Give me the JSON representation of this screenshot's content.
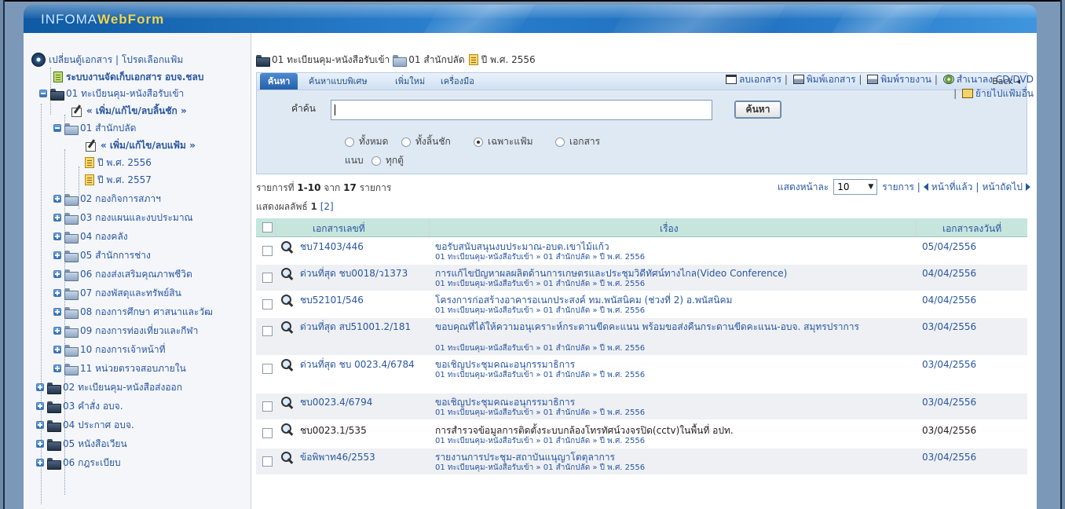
{
  "app": {
    "logo_a": "INFOMA",
    "logo_b": "WebForm"
  },
  "sidebar": {
    "top_link": "เปลี่ยนตู้เอกสาร | โปรดเลือกแฟ้ม",
    "system_title": "ระบบงานจัดเก็บเอกสาร อบจ.ชลบ",
    "items": [
      {
        "label": "01 ทะเบียนคุม-หนังสือรับเข้า"
      },
      {
        "label": "« เพิ่ม/แก้ไข/ลบลิ้นชัก »"
      },
      {
        "label": "01 สำนักปลัด"
      },
      {
        "label": "« เพิ่ม/แก้ไข/ลบแฟ้ม »"
      },
      {
        "label": "ปี พ.ศ. 2556"
      },
      {
        "label": "ปี พ.ศ. 2557"
      },
      {
        "label": "02 กองกิจการสภาฯ"
      },
      {
        "label": "03 กองแผนและงบประมาณ"
      },
      {
        "label": "04 กองคลัง"
      },
      {
        "label": "05 สำนักการช่าง"
      },
      {
        "label": "06 กองส่งเสริมคุณภาพชีวิต"
      },
      {
        "label": "07 กองพัสดุและทรัพย์สิน"
      },
      {
        "label": "08 กองการศึกษา ศาสนาและวัฒ"
      },
      {
        "label": "09 กองการท่องเที่ยวและกีฬา"
      },
      {
        "label": "10 กองการเจ้าหน้าที่"
      },
      {
        "label": "11 หน่วยตรวจสอบภายใน"
      },
      {
        "label": "02 ทะเบียนคุม-หนังสือส่งออก"
      },
      {
        "label": "03 คำสั่ง อบจ."
      },
      {
        "label": "04 ประกาศ อบจ."
      },
      {
        "label": "05 หนังสือเวียน"
      },
      {
        "label": "06 กฎระเบียบ"
      }
    ]
  },
  "breadcrumb": {
    "c1": "01 ทะเบียนคุม-หนังสือรับเข้า",
    "c2": "01 สำนักปลัด",
    "c3": "ปี พ.ศ. 2556"
  },
  "tabs": {
    "search": "ค้นหา",
    "advanced": "ค้นหาแบบพิเศษ",
    "add": "เพิ่มใหม่",
    "tools": "เครื่องมือ",
    "back": "Back ◂"
  },
  "search": {
    "keyword_label": "คำค้น",
    "keyword_value": "",
    "button": "ค้นหา",
    "scope": [
      "ทั้งหมด",
      "ทั้งลิ้นชัก",
      "เฉพาะแฟ้ม",
      "เอกสาร"
    ],
    "attach_label": "แนบ",
    "attach_opt": "ทุกตู้"
  },
  "actions": {
    "delete": "ลบเอกสาร",
    "print_doc": "พิมพ์เอกสาร",
    "print_report": "พิมพ์รายงาน",
    "copy_cd": "สำเนาลง CD/DVD",
    "move": "ย้ายไปแฟ้มอื่น"
  },
  "summary": {
    "prefix": "รายการที่",
    "range": "1-10",
    "from": "จาก",
    "total": "17",
    "suffix": "รายการ"
  },
  "paging": {
    "perpage_label": "แสดงหน้าละ",
    "perpage_value": "10",
    "items_label": "รายการ |",
    "prev": "หน้าที่แล้ว",
    "sep": "|",
    "next": "หน้าถัดไป",
    "results_label": "แสดงผลลัพธ์",
    "current_page": "1",
    "page2": "[2]"
  },
  "table": {
    "headers": {
      "docno": "เอกสารเลขที่",
      "subject": "เรื่อง",
      "date": "เอกสารลงวันที่"
    },
    "rows": [
      {
        "docno": "ชบ71403/446",
        "title": "ขอรับสนับสนุนงบประมาณ-อบต.เขาไม้แก้ว",
        "path": "01 ทะเบียนคุม-หนังสือรับเข้า » 01 สำนักปลัด » ปี พ.ศ. 2556",
        "date": "05/04/2556"
      },
      {
        "docno": "ด่วนที่สุด ชบ0018/ว1373",
        "title": "การแก้ไขปัญหาผลผลิตด้านการเกษตรและประชุมวิดีทัศน์ทางไกล(Video Conference)",
        "path": "01 ทะเบียนคุม-หนังสือรับเข้า » 01 สำนักปลัด » ปี พ.ศ. 2556",
        "date": "04/04/2556"
      },
      {
        "docno": "ชบ52101/546",
        "title": "โครงการก่อสร้างอาคารอเนกประสงค์ ทม.พนัสนิคม (ช่วงที่ 2) อ.พนัสนิคม",
        "path": "01 ทะเบียนคุม-หนังสือรับเข้า » 01 สำนักปลัด » ปี พ.ศ. 2556",
        "date": "04/04/2556"
      },
      {
        "docno": "ด่วนที่สุด สป51001.2/181",
        "title": "ขอบคุณที่ได้ให้ความอนุเคราะห์กระดานขีดคะแนน พร้อมขอส่งคืนกระดานขีดคะแนน-อบจ. สมุทรปราการ",
        "path": "01 ทะเบียนคุม-หนังสือรับเข้า » 01 สำนักปลัด » ปี พ.ศ. 2556",
        "date": "03/04/2556"
      },
      {
        "docno": "ด่วนที่สุด ชบ 0023.4/6784",
        "title": "ขอเชิญประชุมคณะอนุกรรมาธิการ",
        "path": "01 ทะเบียนคุม-หนังสือรับเข้า » 01 สำนักปลัด » ปี พ.ศ. 2556",
        "date": "03/04/2556"
      },
      {
        "docno": "ชบ0023.4/6794",
        "title": "ขอเชิญประชุมคณะอนุกรรมาธิการ",
        "path": "01 ทะเบียนคุม-หนังสือรับเข้า » 01 สำนักปลัด » ปี พ.ศ. 2556",
        "date": "03/04/2556"
      },
      {
        "docno": "ชบ0023.1/535",
        "title": "การสำรวจข้อมูลการติดตั้งระบบกล้องโทรทัศน์วงจรปิด(cctv)ในพื้นที่ อปท.",
        "path": "01 ทะเบียนคุม-หนังสือรับเข้า » 01 สำนักปลัด » ปี พ.ศ. 2556",
        "date": "03/04/2556"
      },
      {
        "docno": "ข้อพิพาท46/2553",
        "title": "รายงานการประชุม-สถาบันแนุญาโตตุลาการ",
        "path": "01 ทะเบียนคุม-หนังสือรับเข้า » 01 สำนักปลัด » ปี พ.ศ. 2556",
        "date": "03/04/2556"
      }
    ]
  }
}
